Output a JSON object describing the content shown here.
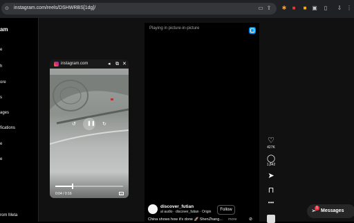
{
  "browser": {
    "url": "instagram.com/reels/DSHWRBS[1dg]/",
    "tab_icons": [
      "cast-icon",
      "share-icon",
      "star-icon",
      "extension-icon",
      "extension-icon",
      "extension-icon",
      "profile-icon",
      "download-icon",
      "menu-icon"
    ]
  },
  "sidebar": {
    "logo": "am",
    "items": [
      {
        "label": "e"
      },
      {
        "label": "h"
      },
      {
        "label": "ore"
      },
      {
        "label": "s"
      },
      {
        "label": "ages"
      },
      {
        "label": "fications"
      },
      {
        "label": "e"
      },
      {
        "label": "e"
      }
    ],
    "footer": "rom Meta"
  },
  "pip": {
    "title": "instagram.com",
    "time": "0:04 / 0:16",
    "progress": 0.26
  },
  "reel": {
    "pip_message": "Playing in picture-in-picture",
    "author": "discover_futian",
    "audio": "al audio · discover_futian · Origin",
    "follow_label": "Follow",
    "caption": "China shows how it's done 🚀 ShenZhang...",
    "more_label": "more",
    "likes": "427K",
    "comments": "1,842"
  },
  "messages": {
    "label": "Messages",
    "badge": "1"
  }
}
